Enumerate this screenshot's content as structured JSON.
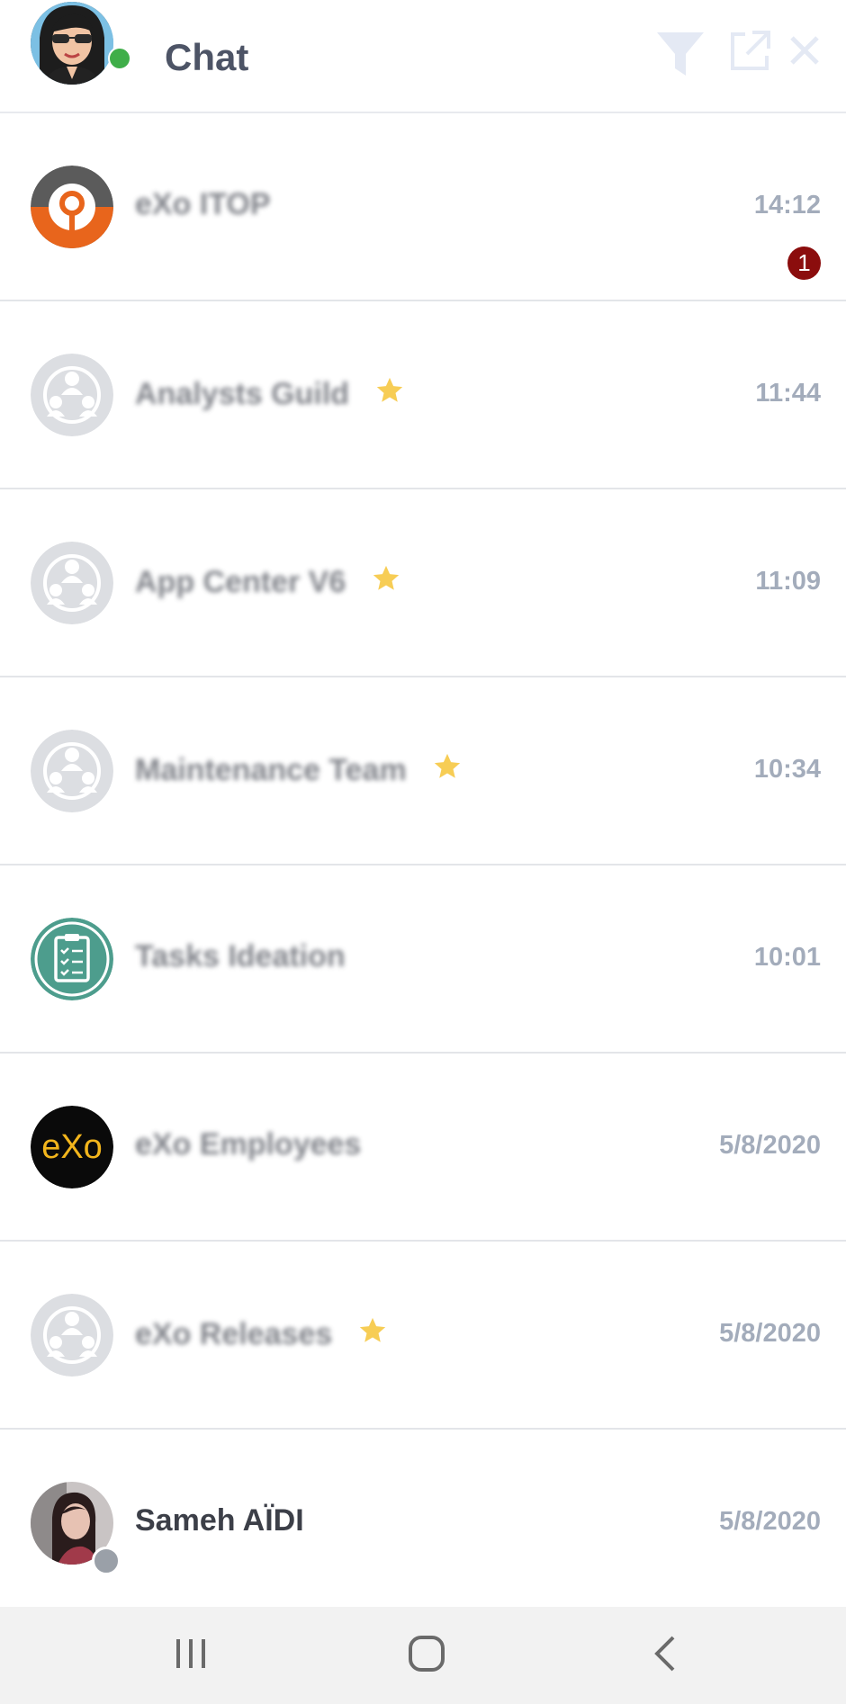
{
  "header": {
    "title": "Chat",
    "icons": [
      "filter-icon",
      "external-link-icon",
      "close-icon"
    ],
    "icon_color": "#e4e9f4",
    "online_color": "#3fae49"
  },
  "conversations": [
    {
      "name": "eXo ITOP",
      "time": "14:12",
      "unread": "1",
      "favorite": false,
      "avatar": "ring-logo"
    },
    {
      "name": "Analysts Guild",
      "time": "11:44",
      "unread": "",
      "favorite": true,
      "avatar": "group-icon"
    },
    {
      "name": "App Center V6",
      "time": "11:09",
      "unread": "",
      "favorite": true,
      "avatar": "group-icon"
    },
    {
      "name": "Maintenance Team",
      "time": "10:34",
      "unread": "",
      "favorite": true,
      "avatar": "group-icon"
    },
    {
      "name": "Tasks Ideation",
      "time": "10:01",
      "unread": "",
      "favorite": false,
      "avatar": "clipboard-icon"
    },
    {
      "name": "eXo Employees",
      "time": "5/8/2020",
      "unread": "",
      "favorite": false,
      "avatar": "exo-logo"
    },
    {
      "name": "eXo Releases",
      "time": "5/8/2020",
      "unread": "",
      "favorite": true,
      "avatar": "group-icon"
    },
    {
      "name": "Sameh AÏDI",
      "time": "5/8/2020",
      "unread": "",
      "favorite": false,
      "avatar": "user-photo"
    }
  ],
  "colors": {
    "badge": "#8b0d0d",
    "star": "#f7cd55",
    "time": "#a3acbb"
  },
  "navbar": {
    "buttons": [
      "recent-apps-icon",
      "home-icon",
      "back-icon"
    ]
  }
}
